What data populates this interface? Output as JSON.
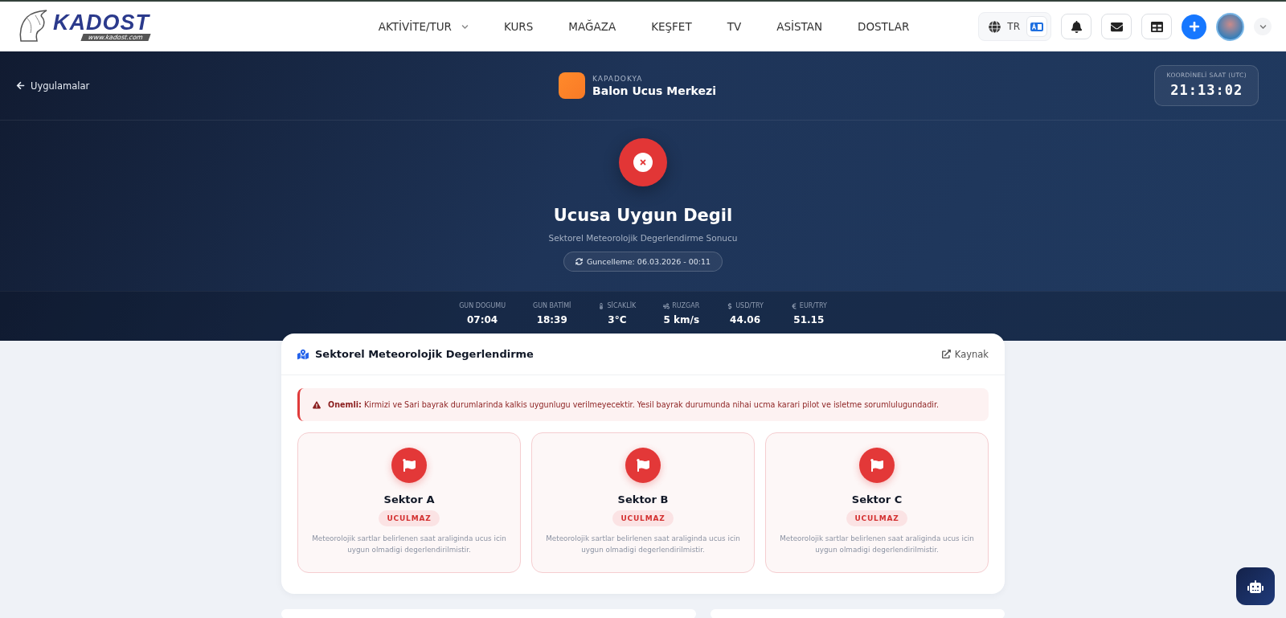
{
  "header": {
    "logo_text": "KADOST",
    "logo_url": "www.kadost.com",
    "language": "TR",
    "nav": [
      {
        "label": "AKTİVİTE/TUR",
        "dropdown": true
      },
      {
        "label": "KURS",
        "dropdown": false
      },
      {
        "label": "MAĞAZA",
        "dropdown": false
      },
      {
        "label": "KEŞFET",
        "dropdown": false
      },
      {
        "label": "TV",
        "dropdown": false
      },
      {
        "label": "ASİSTAN",
        "dropdown": false
      },
      {
        "label": "DOSTLAR",
        "dropdown": false
      }
    ]
  },
  "hero": {
    "back": "Uygulamalar",
    "region": "KAPADOKYA",
    "title": "Balon Ucus Merkezi",
    "clock_label": "KOORDİNELİ SAAT (UTC)",
    "clock_time": "21:13:02",
    "status": {
      "kind": "unfit",
      "title": "Ucusa Uygun Degil",
      "subtitle": "Sektorel Meteorolojik Degerlendirme Sonucu",
      "updated": "Guncelleme: 06.03.2026 - 00:11"
    },
    "stats": [
      {
        "label": "GUN DOGUMU",
        "value": "07:04"
      },
      {
        "label": "GUN BATİMİ",
        "value": "18:39"
      },
      {
        "label": "SİCAKLİK",
        "value": "3°C"
      },
      {
        "label": "RUZGAR",
        "value": "5 km/s"
      },
      {
        "label": "USD/TRY",
        "value": "44.06"
      },
      {
        "label": "EUR/TRY",
        "value": "51.15"
      }
    ]
  },
  "panel": {
    "title": "Sektorel Meteorolojik Degerlendirme",
    "source": "Kaynak",
    "alert": "**Onemli:** Kirmizi ve Sari bayrak durumlarinda kalkis uygunlugu verilmeyecektir. Yesil bayrak durumunda nihai ucma karari pilot ve isletme sorumlulugundadir.",
    "sectors": [
      {
        "name": "Sektor A",
        "badge": "UCULMAZ",
        "description": "Meteorolojik sartlar belirlenen saat araliginda ucus icin uygun olmadigi degerlendirilmistir."
      },
      {
        "name": "Sektor B",
        "badge": "UCULMAZ",
        "description": "Meteorolojik sartlar belirlenen saat araliginda ucus icin uygun olmadigi degerlendirilmistir."
      },
      {
        "name": "Sektor C",
        "badge": "UCULMAZ",
        "description": "Meteorolojik sartlar belirlenen saat araliginda ucus icin uygun olmadigi degerlendirilmistir."
      }
    ]
  }
}
